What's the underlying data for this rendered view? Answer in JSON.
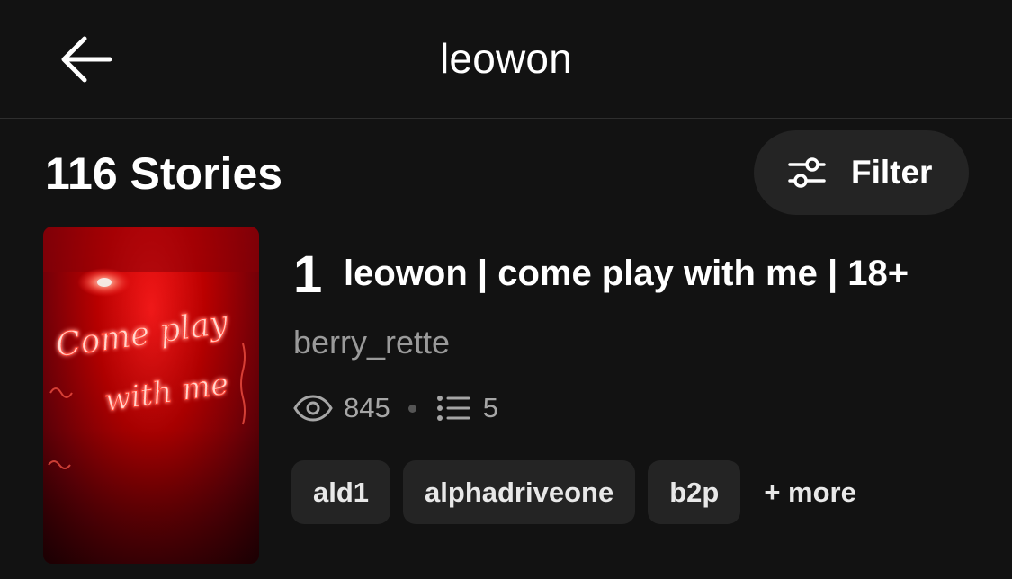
{
  "header": {
    "title": "leowon",
    "back_icon": "arrow-left-icon"
  },
  "stories": {
    "count_label": "116 Stories",
    "filter_label": "Filter",
    "filter_icon": "sliders-icon"
  },
  "story": {
    "rank": "1",
    "title": "leowon | come play with me | 18+",
    "author": "berry_rette",
    "reads": "845",
    "parts": "5",
    "cover_text_line1": "Come play",
    "cover_text_line2": "with me",
    "tags": [
      "ald1",
      "alphadriveone",
      "b2p"
    ],
    "more_label": "+ more"
  },
  "colors": {
    "background": "#121212",
    "surface": "#242424",
    "muted_text": "#9a9a9a",
    "cover_red": "#c40000"
  }
}
